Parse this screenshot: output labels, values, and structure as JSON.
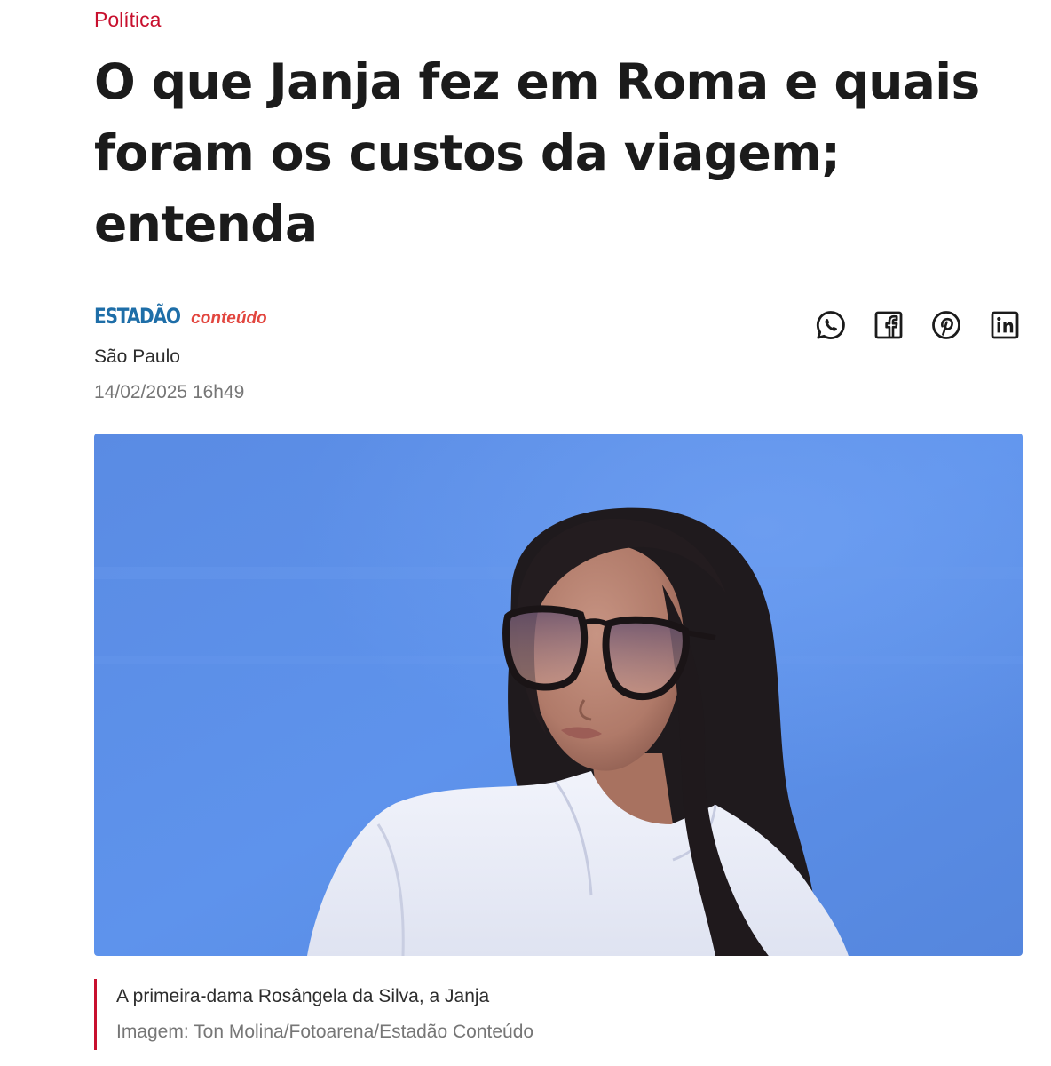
{
  "article": {
    "section": "Política",
    "headline": "O que Janja fez em Roma e quais foram os custos da viagem; entenda",
    "source": {
      "brand": "ESTADÃO",
      "suffix": "conteúdo"
    },
    "location": "São Paulo",
    "datetime": "14/02/2025 16h49"
  },
  "share": {
    "buttons": [
      {
        "icon": "whatsapp-icon"
      },
      {
        "icon": "facebook-icon"
      },
      {
        "icon": "pinterest-icon"
      },
      {
        "icon": "linkedin-icon"
      }
    ]
  },
  "photo": {
    "caption": "A primeira-dama Rosângela da Silva, a Janja",
    "credit": "Imagem: Ton Molina/Fotoarena/Estadão Conteúdo"
  },
  "colors": {
    "accent": "#c8102e",
    "estadao_blue": "#1e6ea8",
    "conteudo_red": "#e2463f",
    "photo_background": "#5a8fe6"
  }
}
